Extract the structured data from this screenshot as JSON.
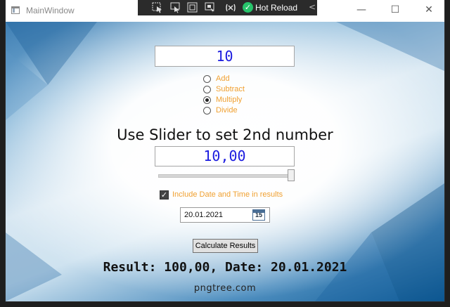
{
  "window": {
    "title": "MainWindow",
    "minimize_glyph": "—",
    "maximize_glyph": "☐",
    "close_glyph": "✕"
  },
  "devtoolbar": {
    "icons": [
      "select-element-icon",
      "pointer-icon",
      "display-layout-adorners-icon",
      "track-focused-element-icon",
      "binding-failures-icon"
    ],
    "hot_reload_label": "Hot Reload",
    "hot_reload_status": "ok",
    "collapse_glyph": "<"
  },
  "first_number": {
    "value": "10"
  },
  "operations": {
    "options": [
      "Add",
      "Subtract",
      "Multiply",
      "Divide"
    ],
    "selected": "Multiply"
  },
  "heading": "Use Slider to set 2nd number",
  "second_number": {
    "value": "10,00"
  },
  "slider": {
    "value_fraction": 1.0
  },
  "include_date": {
    "label": "Include Date and Time in results",
    "checked": true
  },
  "date_picker": {
    "value": "20.01.2021",
    "calendar_day": "15"
  },
  "calculate_button": {
    "label": "Calculate Results"
  },
  "result_text": "Result: 100,00, Date: 20.01.2021",
  "watermark": "pngtree.com",
  "colors": {
    "accent_orange": "#f0a030",
    "number_blue": "#1a1adf",
    "hot_reload_green": "#27c46b"
  }
}
